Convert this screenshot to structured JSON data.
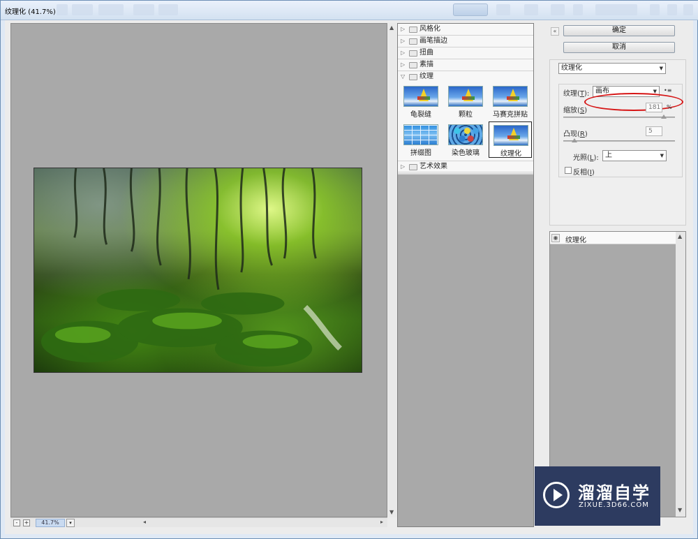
{
  "window": {
    "title": "纹理化 (41.7%)"
  },
  "canvas": {
    "zoom_value": "41.7%",
    "zoom_minus": "-",
    "zoom_plus": "+",
    "zoom_caret": "▾",
    "scroll_up": "▲",
    "scroll_down": "▼",
    "scroll_left": "◂",
    "scroll_right": "▸"
  },
  "gallery": {
    "groups_top": [
      {
        "label": "风格化",
        "arrow": "▷"
      },
      {
        "label": "画笔描边",
        "arrow": "▷"
      },
      {
        "label": "扭曲",
        "arrow": "▷"
      },
      {
        "label": "素描",
        "arrow": "▷"
      },
      {
        "label": "纹理",
        "arrow": "▽"
      }
    ],
    "thumbs": [
      {
        "label": "龟裂缝",
        "icon": "sailboat"
      },
      {
        "label": "颗粒",
        "icon": "sailboat"
      },
      {
        "label": "马赛克拼贴",
        "icon": "sailboat"
      },
      {
        "label": "拼缀图",
        "icon": "mosaic"
      },
      {
        "label": "染色玻璃",
        "icon": "stained-glass"
      },
      {
        "label": "纹理化",
        "icon": "sailboat",
        "selected": true
      }
    ],
    "group_bottom": {
      "label": "艺术效果",
      "arrow": "▷"
    }
  },
  "panel": {
    "collapse": "«",
    "ok_label": "确定",
    "cancel_label": "取消",
    "filter_select": "纹理化",
    "texture_label": "纹理",
    "texture_shortcut": "T",
    "texture_value": "画布",
    "texture_menu_icon": "•≡",
    "scaling_label": "缩放",
    "scaling_shortcut": "S",
    "scaling_value": "181",
    "scaling_unit": "%",
    "scaling_level": 0.9,
    "relief_label": "凸现",
    "relief_shortcut": "R",
    "relief_value": "5",
    "relief_level": 0.1,
    "light_label": "光照",
    "light_shortcut": "L",
    "light_value": "上",
    "invert_label": "反相",
    "invert_shortcut": "I",
    "invert_checked": false,
    "caret": "▼"
  },
  "layers": {
    "items": [
      {
        "label": "纹理化",
        "visible_icon": "eye-icon"
      }
    ],
    "scroll_up": "▲",
    "scroll_down": "▼"
  },
  "watermark": {
    "title": "溜溜自学",
    "subtitle": "ZIXUE.3D66.COM"
  },
  "colors": {
    "highlight": "#d61515",
    "watermark_bg": "#2d3b60",
    "selection": "#c9daf0"
  }
}
